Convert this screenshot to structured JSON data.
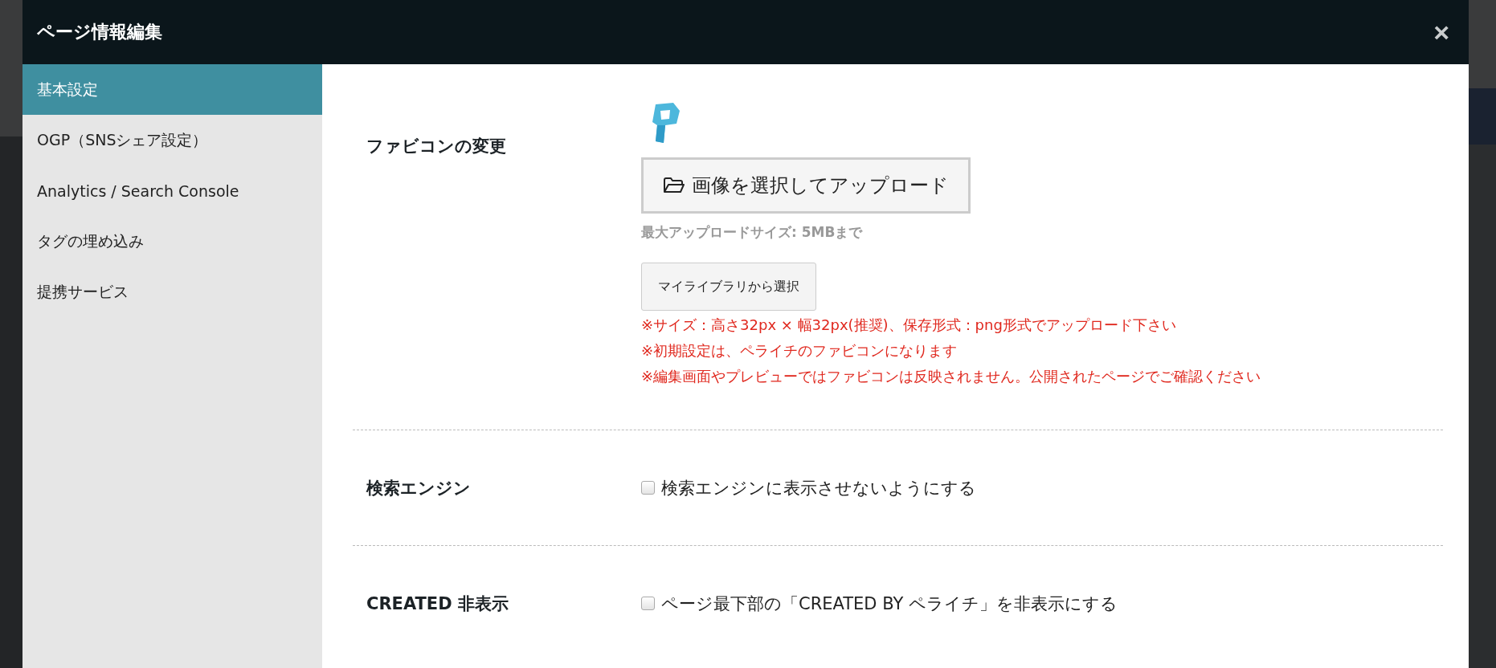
{
  "modal": {
    "title": "ページ情報編集",
    "close": "×"
  },
  "sidebar": {
    "items": [
      {
        "label": "基本設定",
        "selected": true
      },
      {
        "label": "OGP（SNSシェア設定）",
        "selected": false
      },
      {
        "label": "Analytics / Search Console",
        "selected": false
      },
      {
        "label": "タグの埋め込み",
        "selected": false
      },
      {
        "label": "提携サービス",
        "selected": false
      }
    ]
  },
  "favicon": {
    "label": "ファビコンの変更",
    "upload_button": "画像を選択してアップロード",
    "max_size": "最大アップロードサイズ: 5MBまで",
    "library_button": "マイライブラリから選択",
    "notes": [
      "※サイズ：高さ32px × 幅32px(推奨)、保存形式：png形式でアップロード下さい",
      "※初期設定は、ペライチのファビコンになります",
      "※編集画面やプレビューではファビコンは反映されません。公開されたページでご確認ください"
    ]
  },
  "settings": [
    {
      "label": "検索エンジン",
      "option": "検索エンジンに表示させないようにする",
      "checked": false
    },
    {
      "label": "CREATED 非表示",
      "option": "ページ最下部の「CREATED BY ペライチ」を非表示にする",
      "checked": false
    }
  ]
}
